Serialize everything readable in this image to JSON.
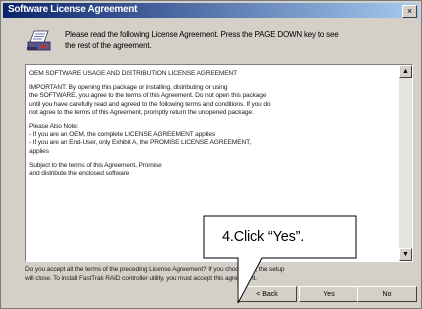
{
  "window": {
    "title": "Software License Agreement",
    "close_glyph": "×"
  },
  "instruction": {
    "icon": "license-document-icon",
    "text": "Please read the following License Agreement.  Press the PAGE DOWN key to see\nthe rest of the agreement."
  },
  "license": {
    "title": "OEM SOFTWARE USAGE AND DISTRIBUTION LICENSE AGREEMENT",
    "paragraph1": "IMPORTANT:  By opening this package or installing, distributing or using\nthe SOFTWARE, you agree to the terms of this Agreement.  Do not open this package\nuntil you have carefully read and agreed to the following terms and conditions.  If you do\nnot agree to the terms of this Agreement, promptly return the unopened package.",
    "paragraph2": "Please Also Note:\n-            If you are an OEM, the complete LICENSE AGREEMENT applies\n-            If you are an End-User, only Exhibit A, the PROMISE LICENSE AGREEMENT,\napplies",
    "paragraph3": "Subject to the terms of this Agreement, Promise\nand distribute the enclosed software"
  },
  "question": "Do you accept all the terms of the preceding License Agreement?  If you choose No, the setup\nwill close.  To install FastTrak RAID controller utility, you must accept this agreement.",
  "buttons": {
    "back": "< Back",
    "yes": "Yes",
    "no": "No"
  },
  "callout": {
    "text": "4.Click “Yes”."
  },
  "colors": {
    "titlebar_start": "#0a246a",
    "titlebar_end": "#a6caf0",
    "window_bg": "#d4d0c8"
  }
}
